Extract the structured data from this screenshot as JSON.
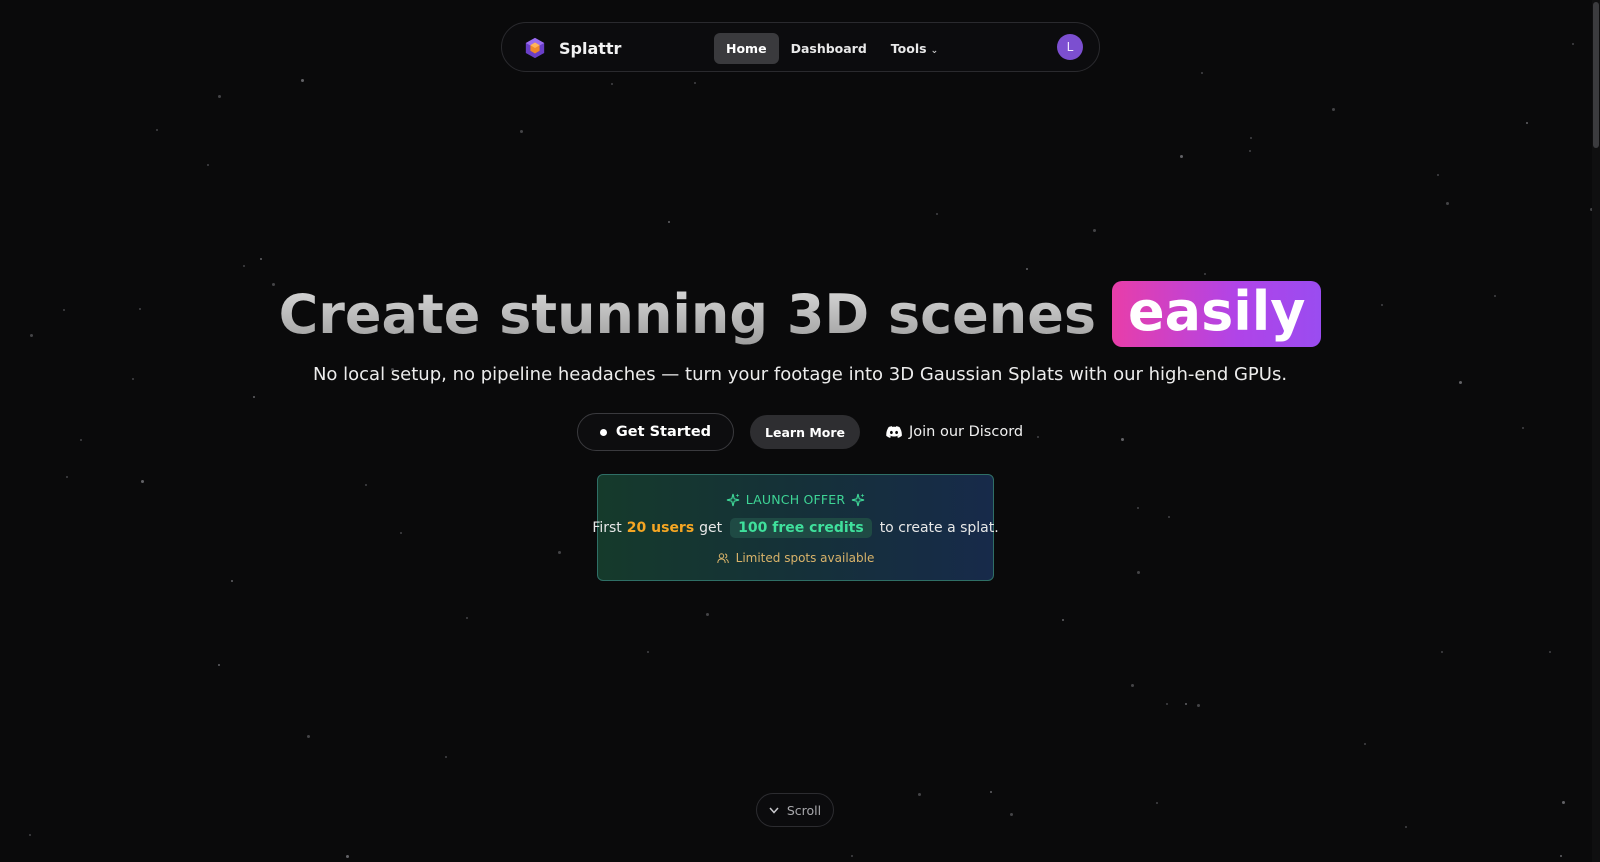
{
  "nav": {
    "brand": "Splattr",
    "links": [
      {
        "label": "Home",
        "active": true
      },
      {
        "label": "Dashboard",
        "active": false
      },
      {
        "label": "Tools",
        "active": false
      }
    ],
    "avatar_initial": "L"
  },
  "hero": {
    "title": "Create stunning 3D scenes",
    "highlight": "easily",
    "subtitle": "No local setup, no pipeline headaches — turn your footage into 3D Gaussian Splats with our high-end GPUs."
  },
  "cta": {
    "primary": "Get Started",
    "secondary": "Learn More",
    "discord": "Join our Discord"
  },
  "offer": {
    "heading": "LAUNCH OFFER",
    "prefix": "First",
    "users": "20 users",
    "mid": "get",
    "credits": "100 free credits",
    "suffix": "to create a splat.",
    "footnote": "Limited spots available"
  },
  "scroll_label": "Scroll",
  "colors": {
    "background": "#0a0a0b",
    "highlight_start": "#e83ea9",
    "highlight_end": "#9a4cf0",
    "offer_green": "#3ed596",
    "offer_orange": "#f5a623",
    "avatar": "#7c4fd0"
  },
  "icons": {
    "brand": "hexagon-cube-icon",
    "tools_chevron": "chevron-down-icon",
    "discord": "discord-icon",
    "sparkles": "sparkles-icon",
    "users": "users-icon",
    "scroll": "chevron-down-icon"
  }
}
